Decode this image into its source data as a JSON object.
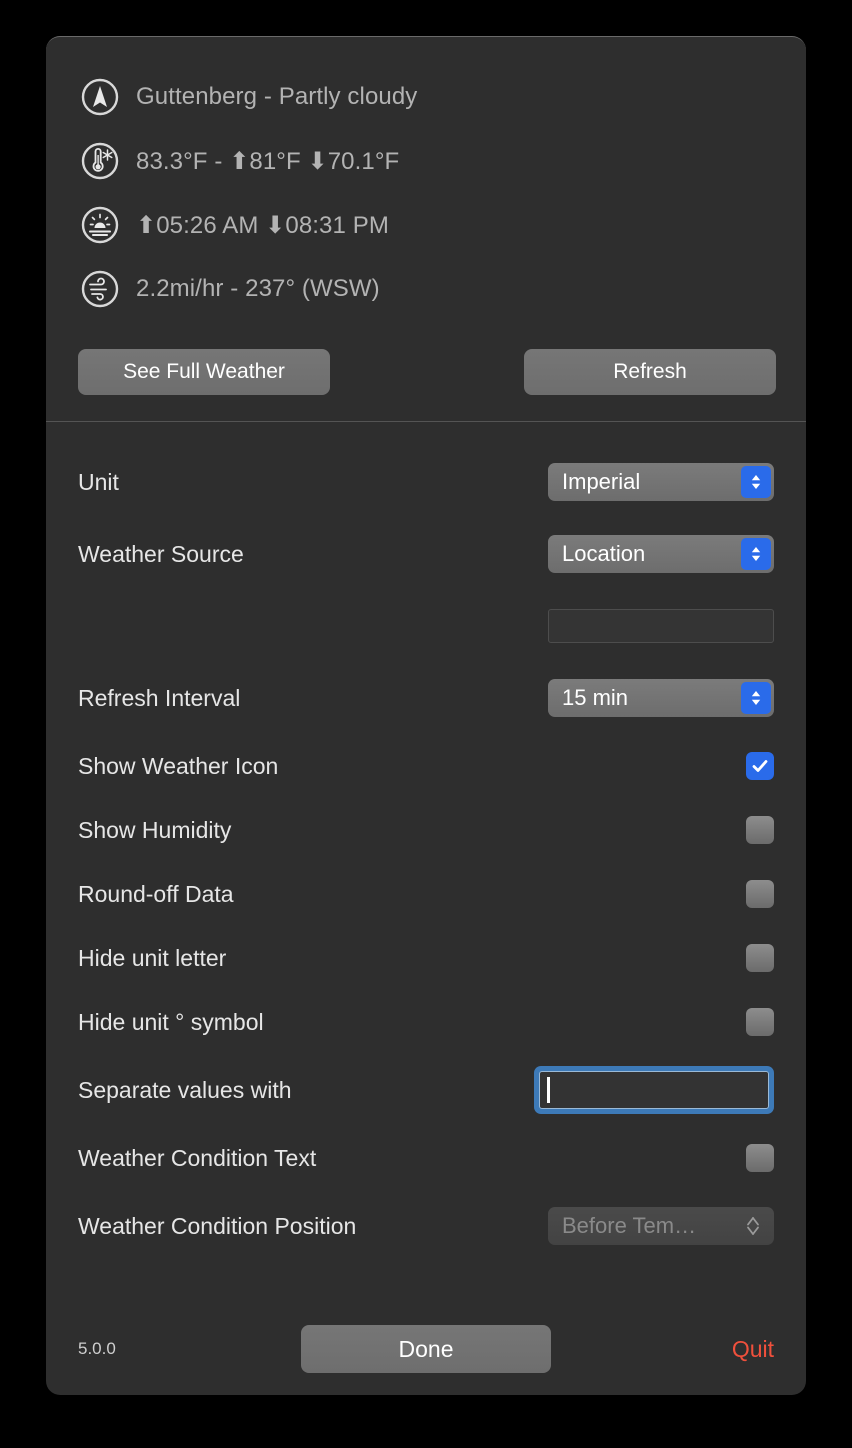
{
  "weather": {
    "rows": [
      {
        "icon": "location-arrow-icon",
        "text": "Guttenberg - Partly cloudy"
      },
      {
        "icon": "thermometer-snowflake-icon",
        "text": "83.3°F - ⬆︎81°F ⬇︎70.1°F"
      },
      {
        "icon": "sunrise-sunset-icon",
        "text": "⬆︎05:26 AM ⬇︎08:31 PM"
      },
      {
        "icon": "wind-icon",
        "text": "2.2mi/hr - 237° (WSW)"
      }
    ],
    "see_full_weather_label": "See Full Weather",
    "refresh_label": "Refresh"
  },
  "settings": {
    "unit": {
      "label": "Unit",
      "value": "Imperial"
    },
    "weather_source": {
      "label": "Weather Source",
      "value": "Location"
    },
    "custom_location": {
      "value": "",
      "placeholder": ""
    },
    "refresh_interval": {
      "label": "Refresh Interval",
      "value": "15 min"
    },
    "show_weather_icon": {
      "label": "Show Weather Icon",
      "checked": true
    },
    "show_humidity": {
      "label": "Show Humidity",
      "checked": false
    },
    "round_off_data": {
      "label": "Round-off Data",
      "checked": false
    },
    "hide_unit_letter": {
      "label": "Hide unit letter",
      "checked": false
    },
    "hide_unit_degree": {
      "label": "Hide unit ° symbol",
      "checked": false
    },
    "separate_values_with": {
      "label": "Separate values with",
      "value": ""
    },
    "weather_condition_text": {
      "label": "Weather Condition Text",
      "checked": false
    },
    "weather_condition_position": {
      "label": "Weather Condition Position",
      "value": "Before Tem…"
    }
  },
  "footer": {
    "version": "5.0.0",
    "done_label": "Done",
    "quit_label": "Quit"
  },
  "colors": {
    "panel_bg": "#2e2e2e",
    "accent_blue": "#2a6bea",
    "focus_ring": "#3d7ab8",
    "quit_red": "#f0503c",
    "button_gray": "#6e6e6e"
  }
}
